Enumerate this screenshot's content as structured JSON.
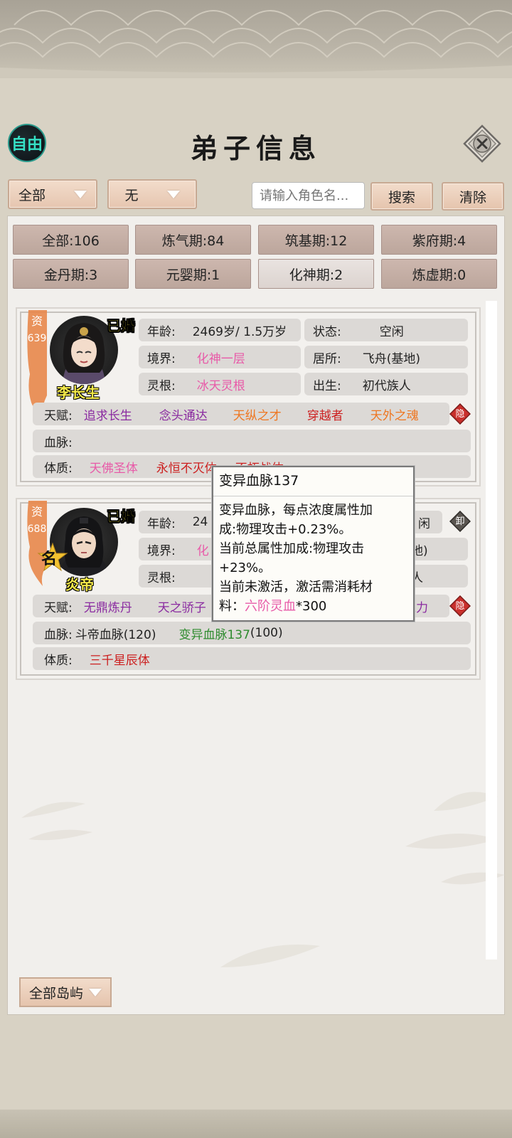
{
  "header": {
    "free_badge": "自由",
    "title": "弟子信息"
  },
  "filters": {
    "filter1": "全部",
    "filter2": "无",
    "search_placeholder": "请输入角色名...",
    "search_label": "搜索",
    "clear_label": "清除"
  },
  "stats": [
    {
      "label": "全部:106"
    },
    {
      "label": "炼气期:84"
    },
    {
      "label": "筑基期:12"
    },
    {
      "label": "紫府期:4"
    },
    {
      "label": "金丹期:3"
    },
    {
      "label": "元婴期:1"
    },
    {
      "label": "化神期:2"
    },
    {
      "label": "炼虚期:0"
    }
  ],
  "cards": [
    {
      "aptitude_label": "资",
      "aptitude": "639",
      "married": "已婚",
      "name": "李长生",
      "age_label": "年龄:",
      "age": "2469岁/ 1.5万岁",
      "status_label": "状态:",
      "status": "空闲",
      "realm_label": "境界:",
      "realm": "化神一层",
      "residence_label": "居所:",
      "residence": "飞舟(基地)",
      "root_label": "灵根:",
      "root": "冰天灵根",
      "birth_label": "出生:",
      "birth": "初代族人",
      "talent_label": "天赋:",
      "talents": [
        "追求长生",
        "念头通达",
        "天纵之才",
        "穿越者",
        "天外之魂"
      ],
      "talent_colors": [
        "#8a2aa0",
        "#8a2aa0",
        "#ee7722",
        "#cc1f1f",
        "#ee7722"
      ],
      "hide_label": "隐",
      "bloodline_label": "血脉:",
      "constitution_label": "体质:",
      "constitutions": [
        "天佛圣体",
        "永恒不灭体",
        "不朽战体"
      ],
      "constitution_colors": [
        "#e85aa8",
        "#cc1f1f",
        "#cc1f1f"
      ]
    },
    {
      "aptitude_label": "资",
      "aptitude": "688",
      "married": "已婚",
      "name": "炎帝",
      "fame": "名",
      "age_label": "年龄:",
      "age": "24",
      "status_tail": "闲",
      "realm_label": "境界:",
      "realm": "化",
      "residence_tail": "地)",
      "root_label": "灵根:",
      "birth_tail": "人",
      "unload_label": "卸",
      "talent_label": "天赋:",
      "talents": [
        "无鼎炼丹",
        "天之骄子"
      ],
      "talent_colors": [
        "#8a2aa0",
        "#8a2aa0"
      ],
      "talent_tail": "之力",
      "hide_label": "隐",
      "bloodline_label": "血脉:",
      "bloodlines": [
        "斗帝血脉(120)",
        "变异血脉137",
        "(100)"
      ],
      "constitution_label": "体质:",
      "constitution": "三千星辰体"
    }
  ],
  "tooltip": {
    "title": "变异血脉137",
    "line1": "变异血脉，每点浓度属性加",
    "line2": "成:物理攻击+0.23%。",
    "line3": "当前总属性加成:物理攻击",
    "line4": "+23%。",
    "line5": "当前未激活，激活需消耗材",
    "line6_prefix": "料：",
    "line6_item": "六阶灵血",
    "line6_suffix": "*300"
  },
  "footer": {
    "island_filter": "全部岛屿"
  },
  "colors": {
    "pink": "#e85aa8",
    "green": "#2e8b2e",
    "red": "#cc1f1f",
    "purple": "#8a2aa0",
    "orange": "#ee7722"
  }
}
